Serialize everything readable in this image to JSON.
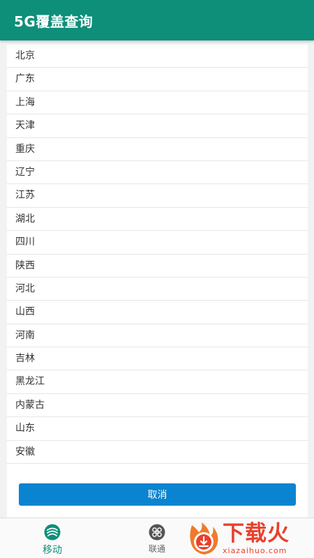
{
  "appbar": {
    "title": "5G覆盖查询"
  },
  "provinces": [
    "北京",
    "广东",
    "上海",
    "天津",
    "重庆",
    "辽宁",
    "江苏",
    "湖北",
    "四川",
    "陕西",
    "河北",
    "山西",
    "河南",
    "吉林",
    "黑龙江",
    "内蒙古",
    "山东",
    "安徽"
  ],
  "dialog": {
    "cancel_label": "取消"
  },
  "bottom_nav": {
    "tabs": [
      {
        "label": "移动",
        "icon": "china-mobile-icon",
        "active": true
      },
      {
        "label": "联通",
        "icon": "china-unicom-icon",
        "active": false
      }
    ]
  },
  "watermark": {
    "main": "下载火",
    "sub": "xiazaihuo.com",
    "icon": "fire-download-logo"
  },
  "colors": {
    "appbar": "#0d8f7a",
    "button": "#0a84d0",
    "active_tab": "#0d8f7a",
    "watermark": "#e8402c"
  }
}
